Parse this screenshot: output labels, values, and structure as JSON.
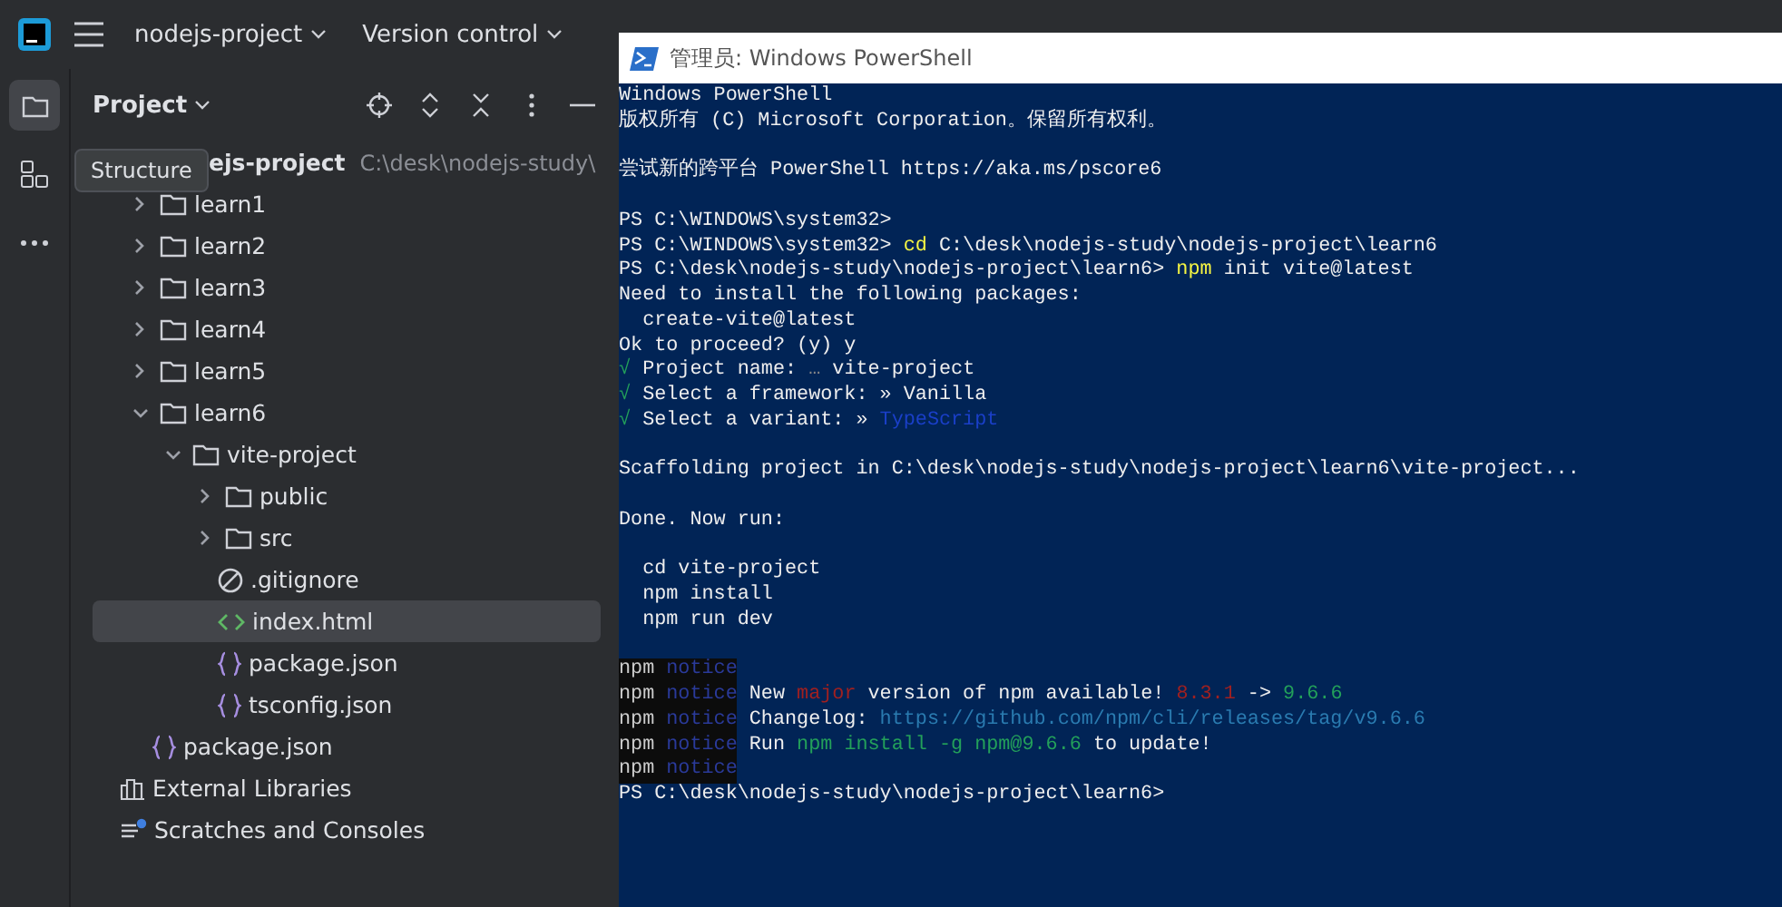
{
  "toolbar": {
    "project": "nodejs-project",
    "vcs": "Version control"
  },
  "panel": {
    "title": "Project",
    "tooltip": "Structure"
  },
  "tree": [
    {
      "label": "ejs-project",
      "path": "C:\\desk\\nodejs-study\\",
      "selected": false,
      "children": [
        {
          "kind": "folder",
          "label": "learn1",
          "expanded": false,
          "selected": false
        },
        {
          "kind": "folder",
          "label": "learn2",
          "expanded": false,
          "selected": false
        },
        {
          "kind": "folder",
          "label": "learn3",
          "expanded": false,
          "selected": false
        },
        {
          "kind": "folder",
          "label": "learn4",
          "expanded": false,
          "selected": false
        },
        {
          "kind": "folder",
          "label": "learn5",
          "expanded": false,
          "selected": false
        },
        {
          "kind": "folder",
          "label": "learn6",
          "expanded": true,
          "selected": false,
          "children": [
            {
              "kind": "folder",
              "label": "vite-project",
              "expanded": true,
              "selected": false,
              "children": [
                {
                  "kind": "folder",
                  "label": "public",
                  "expanded": false,
                  "selected": false
                },
                {
                  "kind": "folder",
                  "label": "src",
                  "expanded": false,
                  "selected": false
                },
                {
                  "kind": "ignore",
                  "label": ".gitignore",
                  "selected": false
                },
                {
                  "kind": "html",
                  "label": "index.html",
                  "selected": true
                },
                {
                  "kind": "json",
                  "label": "package.json",
                  "selected": false
                },
                {
                  "kind": "json",
                  "label": "tsconfig.json",
                  "selected": false
                }
              ]
            }
          ]
        },
        {
          "kind": "json",
          "label": "package.json",
          "selected": false
        }
      ]
    },
    {
      "kind": "libraries",
      "label": "External Libraries",
      "selected": false
    },
    {
      "kind": "scratches",
      "label": "Scratches and Consoles",
      "selected": false
    }
  ],
  "terminal": {
    "title": "管理员: Windows PowerShell",
    "lines": [
      {
        "gap": false,
        "segments": [
          {
            "text": "Windows PowerShell",
            "kind": "plain"
          }
        ]
      },
      {
        "gap": false,
        "segments": [
          {
            "text": "版权所有 (C) Microsoft Corporation。保留所有权利。",
            "kind": "plain"
          }
        ]
      },
      {
        "gap": true,
        "segments": [
          {
            "text": "尝试新的跨平台 PowerShell https://aka.ms/pscore6",
            "kind": "plain"
          }
        ]
      },
      {
        "gap": true,
        "segments": [
          {
            "text": "PS C:\\WINDOWS\\system32>",
            "kind": "plain"
          }
        ]
      },
      {
        "gap": false,
        "segments": [
          {
            "text": "PS C:\\WINDOWS\\system32> ",
            "kind": "plain"
          },
          {
            "text": "cd",
            "kind": "yellow"
          },
          {
            "text": " C:\\desk\\nodejs-study\\nodejs-project\\learn6",
            "kind": "plain"
          }
        ]
      },
      {
        "gap": false,
        "segments": [
          {
            "text": "PS C:\\desk\\nodejs-study\\nodejs-project\\learn6> ",
            "kind": "plain"
          },
          {
            "text": "npm",
            "kind": "yellow"
          },
          {
            "text": " init vite@latest",
            "kind": "plain"
          }
        ]
      },
      {
        "gap": false,
        "segments": [
          {
            "text": "Need to install the following packages:",
            "kind": "plain"
          }
        ]
      },
      {
        "gap": false,
        "segments": [
          {
            "text": "  create-vite@latest",
            "kind": "plain"
          }
        ]
      },
      {
        "gap": false,
        "segments": [
          {
            "text": "Ok to proceed? (y) y",
            "kind": "plain"
          }
        ]
      },
      {
        "gap": false,
        "segments": [
          {
            "text": "√",
            "kind": "green"
          },
          {
            "text": " Project name: ",
            "kind": "plain"
          },
          {
            "text": "…",
            "kind": "gray"
          },
          {
            "text": " vite-project",
            "kind": "plain"
          }
        ]
      },
      {
        "gap": false,
        "segments": [
          {
            "text": "√",
            "kind": "green"
          },
          {
            "text": " Select a framework: » Vanilla",
            "kind": "plain"
          }
        ]
      },
      {
        "gap": false,
        "segments": [
          {
            "text": "√",
            "kind": "green"
          },
          {
            "text": " Select a variant: » ",
            "kind": "plain"
          },
          {
            "text": "TypeScript",
            "kind": "blue"
          }
        ]
      },
      {
        "gap": true,
        "segments": [
          {
            "text": "Scaffolding project in C:\\desk\\nodejs-study\\nodejs-project\\learn6\\vite-project...",
            "kind": "plain"
          }
        ]
      },
      {
        "gap": true,
        "segments": [
          {
            "text": "Done. Now run:",
            "kind": "plain"
          }
        ]
      },
      {
        "gap": true,
        "segments": [
          {
            "text": "  cd vite-project",
            "kind": "plain"
          }
        ]
      },
      {
        "gap": false,
        "segments": [
          {
            "text": "  npm install",
            "kind": "plain"
          }
        ]
      },
      {
        "gap": false,
        "segments": [
          {
            "text": "  npm run dev",
            "kind": "plain"
          }
        ]
      },
      {
        "gap": true,
        "segments": [
          {
            "text": "npm",
            "kind": "npm"
          },
          {
            "text": " notice",
            "kind": "notice"
          }
        ]
      },
      {
        "gap": false,
        "segments": [
          {
            "text": "npm",
            "kind": "npm"
          },
          {
            "text": " notice",
            "kind": "notice"
          },
          {
            "text": " New ",
            "kind": "plain"
          },
          {
            "text": "major",
            "kind": "red"
          },
          {
            "text": " version of npm available! ",
            "kind": "plain"
          },
          {
            "text": "8.3.1",
            "kind": "red"
          },
          {
            "text": " -> ",
            "kind": "plain"
          },
          {
            "text": "9.6.6",
            "kind": "green"
          }
        ]
      },
      {
        "gap": false,
        "segments": [
          {
            "text": "npm",
            "kind": "npm"
          },
          {
            "text": " notice",
            "kind": "notice"
          },
          {
            "text": " Changelog: ",
            "kind": "plain"
          },
          {
            "text": "https://github.com/npm/cli/releases/tag/v9.6.6",
            "kind": "link"
          }
        ]
      },
      {
        "gap": false,
        "segments": [
          {
            "text": "npm",
            "kind": "npm"
          },
          {
            "text": " notice",
            "kind": "notice"
          },
          {
            "text": " Run ",
            "kind": "plain"
          },
          {
            "text": "npm install -g npm@9.6.6",
            "kind": "green"
          },
          {
            "text": " to update!",
            "kind": "plain"
          }
        ]
      },
      {
        "gap": false,
        "segments": [
          {
            "text": "npm",
            "kind": "npm"
          },
          {
            "text": " notice",
            "kind": "notice"
          }
        ]
      },
      {
        "gap": false,
        "segments": [
          {
            "text": "PS C:\\desk\\nodejs-study\\nodejs-project\\learn6>",
            "kind": "plain"
          }
        ]
      }
    ]
  }
}
